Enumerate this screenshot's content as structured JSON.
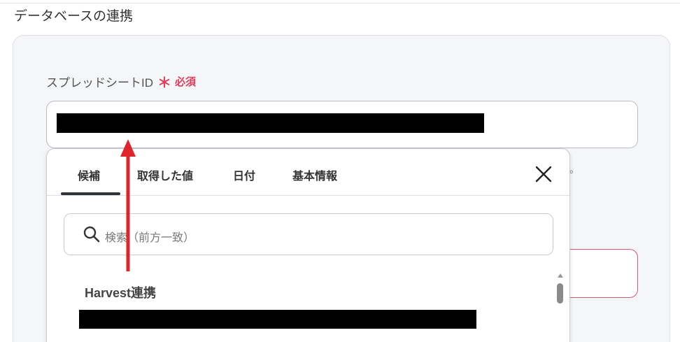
{
  "section_title": "データベースの連携",
  "field": {
    "label": "スプレッドシートID",
    "required_mark": "＊",
    "required_text": "必須"
  },
  "hint_fragment": "。",
  "popup": {
    "tabs": [
      {
        "label": "候補",
        "active": true
      },
      {
        "label": "取得した値",
        "active": false
      },
      {
        "label": "日付",
        "active": false
      },
      {
        "label": "基本情報",
        "active": false
      }
    ],
    "search_placeholder": "検索（前方一致）",
    "list_title": "Harvest連携"
  },
  "colors": {
    "required": "#e03c5b",
    "arrow": "#e0242b",
    "panel_bg": "#f5f6f7"
  }
}
